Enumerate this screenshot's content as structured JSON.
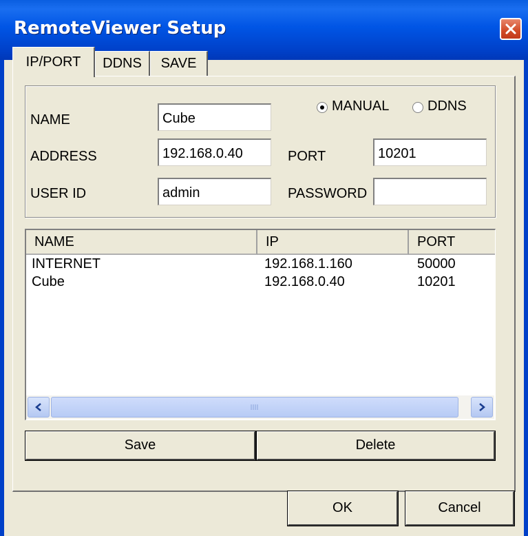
{
  "window": {
    "title": "RemoteViewer Setup"
  },
  "tabs": [
    {
      "label": "IP/PORT"
    },
    {
      "label": "DDNS"
    },
    {
      "label": "SAVE"
    }
  ],
  "form": {
    "name_label": "NAME",
    "name_value": "Cube",
    "address_label": "ADDRESS",
    "address_value": "192.168.0.40",
    "userid_label": "USER ID",
    "userid_value": "admin",
    "port_label": "PORT",
    "port_value": "10201",
    "password_label": "PASSWORD",
    "password_value": "",
    "mode_options": [
      {
        "label": "MANUAL",
        "selected": true
      },
      {
        "label": "DDNS",
        "selected": false
      }
    ]
  },
  "list": {
    "columns": [
      "NAME",
      "IP",
      "PORT"
    ],
    "rows": [
      [
        "INTERNET",
        "192.168.1.160",
        "50000"
      ],
      [
        "Cube",
        "192.168.0.40",
        "10201"
      ]
    ]
  },
  "actions": {
    "save_label": "Save",
    "delete_label": "Delete",
    "ok_label": "OK",
    "cancel_label": "Cancel"
  },
  "colors": {
    "titlebar": "#0055e5",
    "face": "#ece9d8",
    "close": "#d14a27"
  }
}
